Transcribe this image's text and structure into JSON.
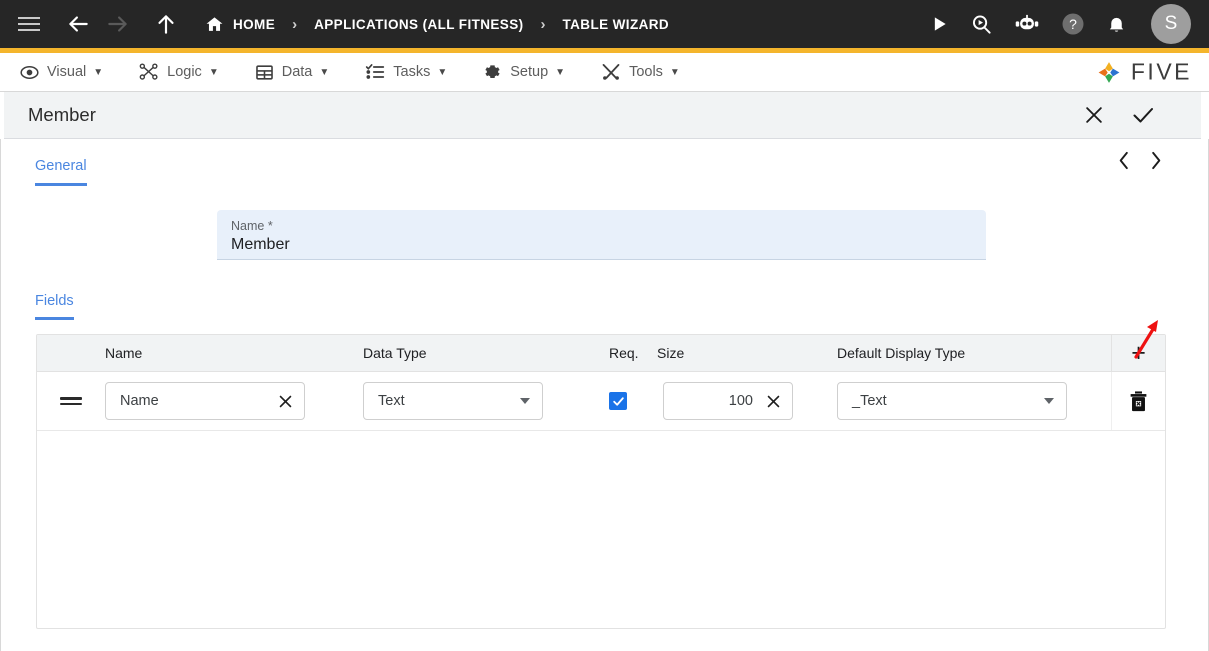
{
  "topbar": {
    "nav_icons": [
      "menu-icon",
      "back-arrow-icon",
      "forward-arrow-icon",
      "up-arrow-icon"
    ],
    "home_label": "HOME",
    "separator": "›",
    "breadcrumbs": [
      "APPLICATIONS (ALL FITNESS)",
      "TABLE WIZARD"
    ],
    "right_icons": [
      "run-icon",
      "search-run-icon",
      "robot-icon",
      "help-icon",
      "notifications-icon"
    ],
    "avatar_initial": "S",
    "accent_color": "#f4b52c",
    "background_color": "#262626"
  },
  "menubar": {
    "items": [
      {
        "label": "Visual",
        "icon": "eye-icon",
        "caret": "▼"
      },
      {
        "label": "Logic",
        "icon": "logic-nodes-icon",
        "caret": "▼"
      },
      {
        "label": "Data",
        "icon": "table-grid-icon",
        "caret": "▼"
      },
      {
        "label": "Tasks",
        "icon": "checklist-icon",
        "caret": "▼"
      },
      {
        "label": "Setup",
        "icon": "gear-icon",
        "caret": "▼"
      },
      {
        "label": "Tools",
        "icon": "tools-icon",
        "caret": "▼"
      }
    ],
    "brand": "FIVE"
  },
  "titlebar": {
    "title": "Member",
    "close_icon": "close-icon",
    "confirm_icon": "check-icon"
  },
  "general": {
    "tab_label": "General",
    "prev_icon": "‹",
    "next_icon": "›",
    "name_field": {
      "label": "Name *",
      "value": "Member",
      "placeholder": "Name"
    }
  },
  "fields": {
    "tab_label": "Fields",
    "add_label": "+",
    "columns": [
      "",
      "Name",
      "Data Type",
      "Req.",
      "Size",
      "Default Display Type",
      ""
    ],
    "rows": [
      {
        "name": "Name",
        "data_type": "Text",
        "required": true,
        "size": "100",
        "default_display_type": "_Text"
      }
    ]
  },
  "annotation": {
    "red_arrow_color": "#ee1111"
  }
}
